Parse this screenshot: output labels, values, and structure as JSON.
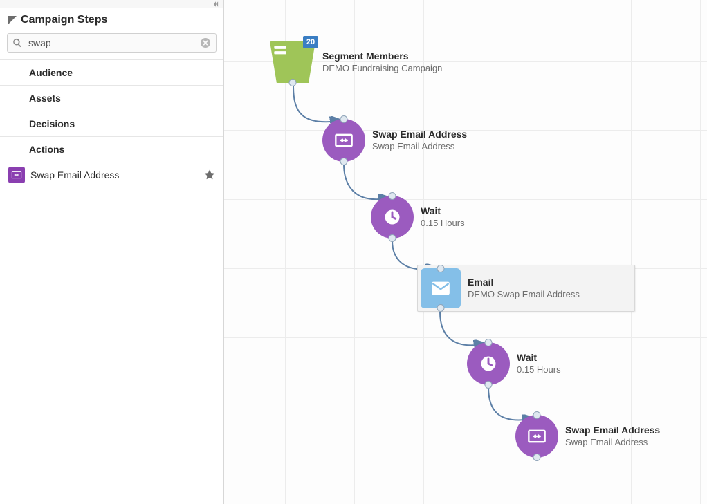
{
  "sidebar": {
    "title": "Campaign Steps",
    "search_value": "swap",
    "categories": [
      {
        "label": "Audience"
      },
      {
        "label": "Assets"
      },
      {
        "label": "Decisions"
      },
      {
        "label": "Actions"
      }
    ],
    "result": {
      "label": "Swap Email Address",
      "icon": "swap-email-icon"
    }
  },
  "canvas": {
    "nodes": {
      "segment": {
        "title": "Segment Members",
        "sub": "DEMO Fundraising Campaign",
        "badge": "20",
        "icon": "segment-icon"
      },
      "swap1": {
        "title": "Swap Email Address",
        "sub": "Swap Email Address",
        "icon": "swap-email-icon"
      },
      "wait1": {
        "title": "Wait",
        "sub": "0.15 Hours",
        "icon": "clock-icon"
      },
      "email": {
        "title": "Email",
        "sub": "DEMO Swap Email Address",
        "icon": "envelope-icon"
      },
      "wait2": {
        "title": "Wait",
        "sub": "0.15 Hours",
        "icon": "clock-icon"
      },
      "swap2": {
        "title": "Swap Email Address",
        "sub": "Swap Email Address",
        "icon": "swap-email-icon"
      }
    }
  }
}
